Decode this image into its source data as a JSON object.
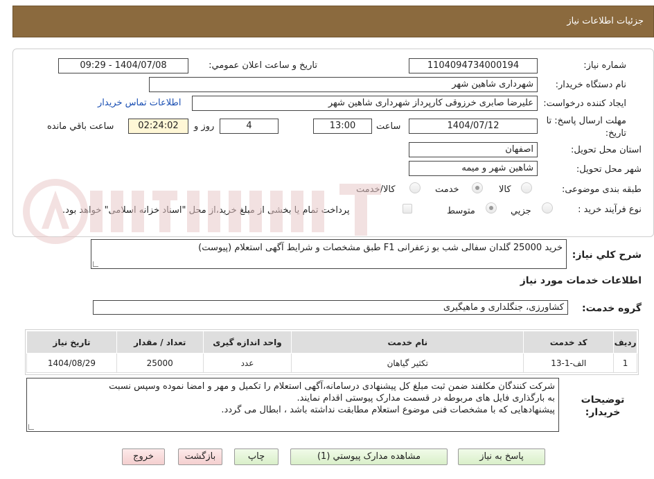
{
  "header": {
    "title": "جزئیات اطلاعات نیاز"
  },
  "form": {
    "need_number_label": "شماره نیاز:",
    "need_number": "1104094734000194",
    "announce_label": "تاریخ و ساعت اعلان عمومي:",
    "announce_value": "1404/07/08 - 09:29",
    "buyer_org_label": "نام دستگاه خريدار:",
    "buyer_org": "شهرداری شاهین شهر",
    "creator_label": "ايجاد كننده درخواست:",
    "creator": "علیرضا صابری خرزوقی کارپرداز شهرداری شاهین شهر",
    "contact_link": "اطلاعات تماس خريدار",
    "deadline_label": "مهلت ارسال پاسخ: تا تاريخ:",
    "deadline_date": "1404/07/12",
    "time_label": "ساعت",
    "deadline_time": "13:00",
    "days_value": "4",
    "days_label": "روز و",
    "remaining_time": "02:24:02",
    "remaining_label": "ساعت باقي مانده",
    "province_label": "استان محل تحویل:",
    "province": "اصفهان",
    "city_label": "شهر محل تحویل:",
    "city": "شاهین شهر و میمه",
    "category_label": "طبقه بندی موضوعی:",
    "category_options": [
      "كالا",
      "خدمت",
      "كالا/خدمت"
    ],
    "category_selected": "خدمت",
    "process_label": "نوع فرآيند خريد :",
    "process_options": [
      "جزيي",
      "متوسط"
    ],
    "process_selected": "متوسط",
    "payment_note": "پرداخت تمام يا بخشی از مبلغ خريد،از محل \"اسناد خزانه اسلامی\" خواهد بود."
  },
  "description": {
    "label": "شرح كلي نياز:",
    "text": "خرید 25000 گلدان سفالی شب بو زعفرانی F1 طبق مشخصات و شرایط  آگهی استعلام  (پیوست)"
  },
  "services": {
    "section_title": "اطلاعات خدمات مورد نياز",
    "group_label": "گروه خدمت:",
    "group_value": "کشاورزی، جنگلداری و ماهیگیری",
    "columns": [
      "رديف",
      "كد خدمت",
      "نام خدمت",
      "واحد اندازه گيری",
      "تعداد / مقدار",
      "تاريخ نياز"
    ],
    "rows": [
      {
        "row": "1",
        "code": "الف-1-13",
        "name": "تکثیر گیاهان",
        "unit": "عدد",
        "qty": "25000",
        "date": "1404/08/29"
      }
    ]
  },
  "buyer_notes": {
    "label": "توضيحات خريدار:",
    "line1": "شرکت کنندگان مکلفند ضمن ثبت مبلغ کل پیشنهادی درسامانه،آگهی استعلام را  تکمیل و مهر و امضا نموده وسپس نسبت",
    "line2": "به بارگذاری فایل های مربوطه در قسمت مدارک پیوستی اقدام نمایند.",
    "line3": "پیشنهادهایی که با مشخصات فنی موضوع استعلام مطابقت نداشته باشد ، ابطال می گردد."
  },
  "buttons": {
    "reply": "پاسخ به نياز",
    "attachments": "مشاهده مدارک پیوستي (1)",
    "print": "چاپ",
    "back": "بازگشت",
    "exit": "خروج"
  },
  "colors": {
    "header_bg": "#8b6a3e",
    "link": "#1a4fb3",
    "green_button": "#d9efc9",
    "pink_button": "#f4cfcf"
  }
}
